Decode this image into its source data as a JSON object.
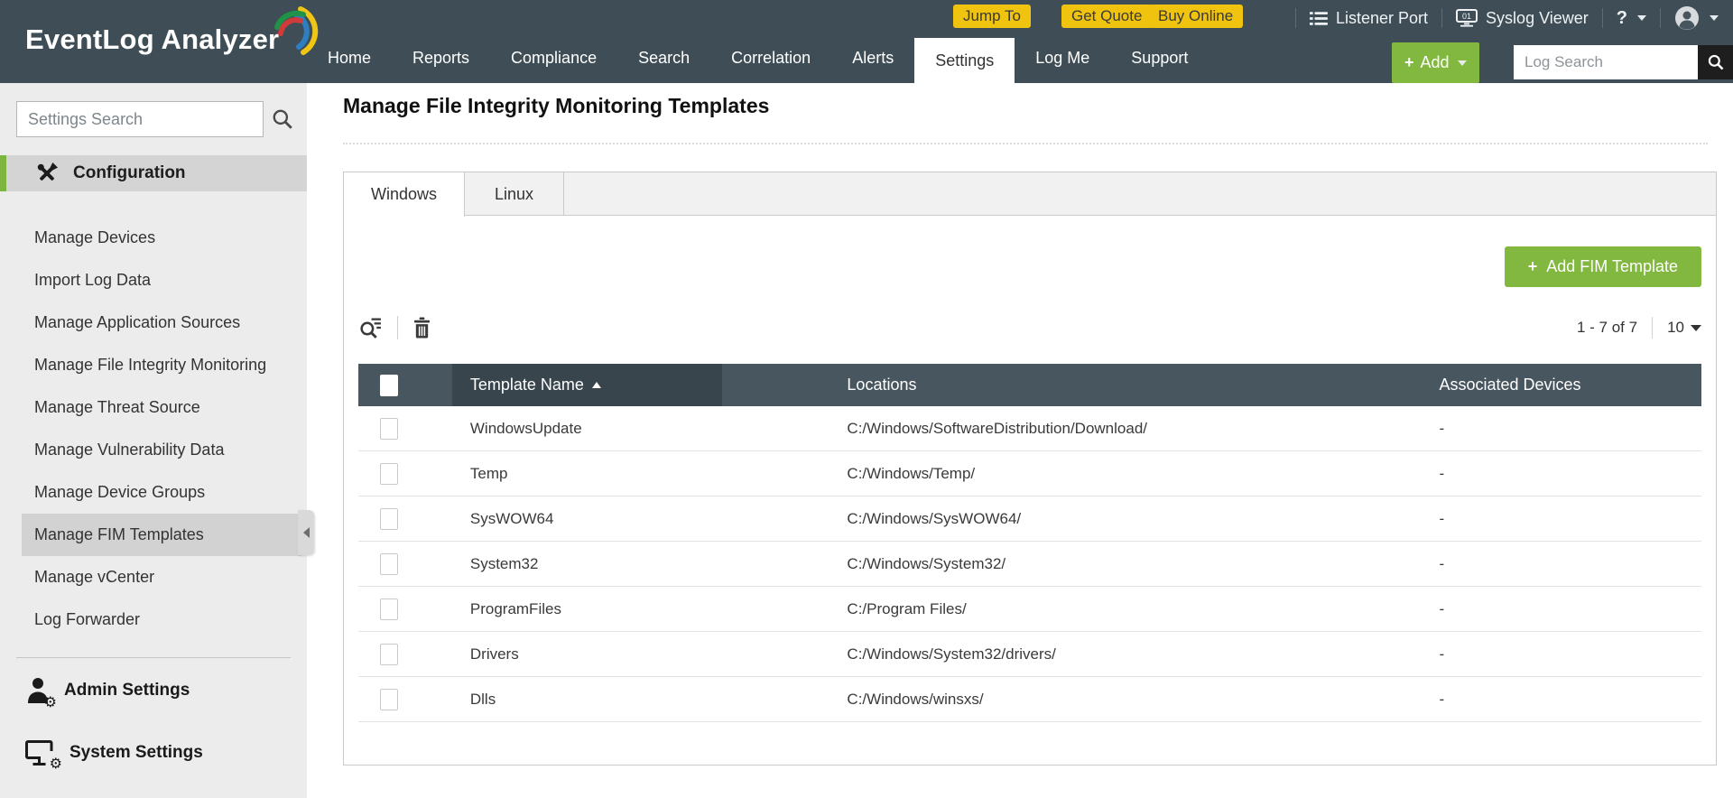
{
  "colors": {
    "header_bg": "#3f4e56",
    "brand_yellow": "#f0c30f",
    "accent_green": "#82b740",
    "table_header_bg": "#47565f",
    "sorted_column_bg": "#39454d",
    "sidebar_bg": "#ececec",
    "selected_item_bg": "#d2d2d2"
  },
  "header": {
    "logo_text": "EventLog Analyzer",
    "top_buttons": [
      {
        "label": "Jump To"
      },
      {
        "label": "Get Quote"
      },
      {
        "label": "Buy Online"
      }
    ],
    "utilities": [
      {
        "label": "Listener Port",
        "icon": "listener-port-icon"
      },
      {
        "label": "Syslog Viewer",
        "icon": "syslog-viewer-icon"
      }
    ],
    "help_label": "?",
    "nav": [
      {
        "label": "Home"
      },
      {
        "label": "Reports"
      },
      {
        "label": "Compliance"
      },
      {
        "label": "Search"
      },
      {
        "label": "Correlation"
      },
      {
        "label": "Alerts"
      },
      {
        "label": "Settings",
        "active": true
      },
      {
        "label": "Log Me"
      },
      {
        "label": "Support"
      }
    ],
    "add_button_label": "Add",
    "log_search_placeholder": "Log Search"
  },
  "sidebar": {
    "search_placeholder": "Settings Search",
    "section_label": "Configuration",
    "items": [
      {
        "label": "Manage Devices"
      },
      {
        "label": "Import Log Data"
      },
      {
        "label": "Manage Application Sources"
      },
      {
        "label": "Manage File Integrity Monitoring"
      },
      {
        "label": "Manage Threat Source"
      },
      {
        "label": "Manage Vulnerability Data"
      },
      {
        "label": "Manage Device Groups"
      },
      {
        "label": "Manage FIM Templates",
        "active": true
      },
      {
        "label": "Manage vCenter"
      },
      {
        "label": "Log Forwarder"
      }
    ],
    "footer_items": {
      "admin": "Admin Settings",
      "system": "System Settings"
    }
  },
  "main": {
    "title": "Manage File Integrity Monitoring Templates",
    "tabs": [
      {
        "label": "Windows",
        "active": true
      },
      {
        "label": "Linux"
      }
    ],
    "add_template_label": "Add FIM Template",
    "pagination": {
      "range": "1 - 7 of 7",
      "page_size": "10"
    },
    "table": {
      "columns": {
        "name": "Template Name",
        "locations": "Locations",
        "devices": "Associated Devices"
      },
      "sort": {
        "column": "Template Name",
        "direction": "ascending"
      },
      "rows": [
        {
          "name": "WindowsUpdate",
          "location": "C:/Windows/SoftwareDistribution/Download/",
          "devices": "-"
        },
        {
          "name": "Temp",
          "location": "C:/Windows/Temp/",
          "devices": "-"
        },
        {
          "name": "SysWOW64",
          "location": "C:/Windows/SysWOW64/",
          "devices": "-"
        },
        {
          "name": "System32",
          "location": "C:/Windows/System32/",
          "devices": "-"
        },
        {
          "name": "ProgramFiles",
          "location": "C:/Program Files/",
          "devices": "-"
        },
        {
          "name": "Drivers",
          "location": "C:/Windows/System32/drivers/",
          "devices": "-"
        },
        {
          "name": "Dlls",
          "location": "C:/Windows/winsxs/",
          "devices": "-"
        }
      ]
    }
  }
}
